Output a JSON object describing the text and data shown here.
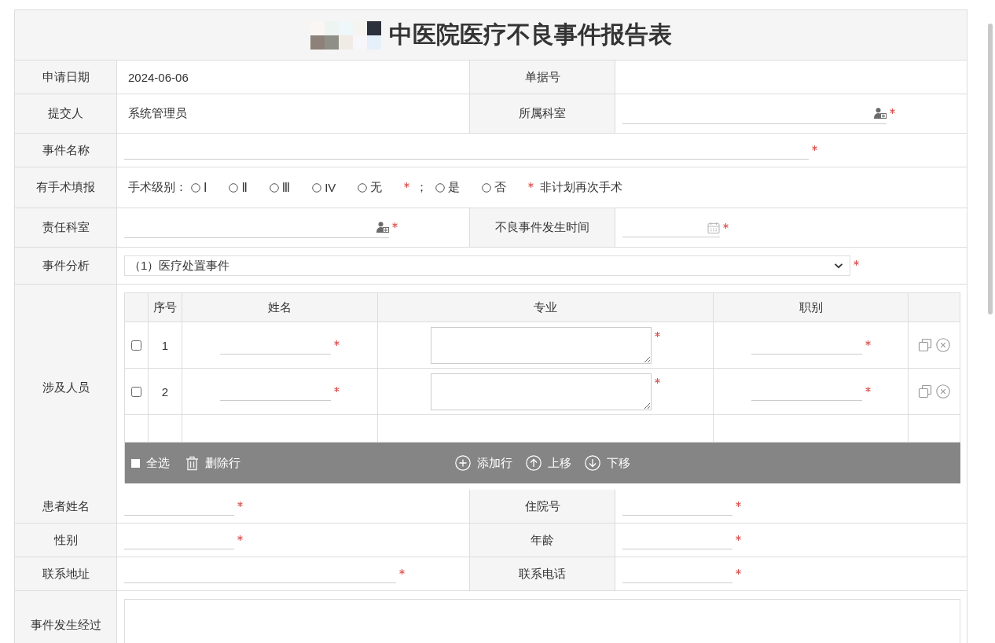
{
  "form": {
    "title": "中医院医疗不良事件报告表",
    "rows": [
      {
        "cells": [
          {
            "label": "申请日期",
            "field": {
              "kind": "static",
              "value": "2024-06-06"
            }
          },
          {
            "label": "单据号"
          }
        ]
      },
      {
        "cells": [
          {
            "label": "提交人",
            "field": {
              "kind": "static",
              "value": "系统管理员"
            }
          },
          {
            "label": "所属科室",
            "field": {
              "kind": "lookup",
              "required": true
            }
          }
        ]
      },
      {
        "cells": [
          {
            "label": "事件名称",
            "field": {
              "kind": "wide-input",
              "required": true
            }
          }
        ]
      },
      {
        "cells": [
          {
            "label": "有手术填报",
            "field": {
              "kind": "radio-groups",
              "groups": [
                {
                  "label": "手术级别：",
                  "options": [
                    {
                      "label": "Ⅰ",
                      "selected": false
                    },
                    {
                      "label": "Ⅱ",
                      "selected": false
                    },
                    {
                      "label": "Ⅲ",
                      "selected": false
                    },
                    {
                      "label": "IV",
                      "selected": false
                    },
                    {
                      "label": "无",
                      "selected": false
                    }
                  ],
                  "required": true,
                  "suffix": "；"
                },
                {
                  "options": [
                    {
                      "label": "是",
                      "selected": false
                    },
                    {
                      "label": "否",
                      "selected": false
                    }
                  ],
                  "required": true,
                  "suffix": "非计划再次手术"
                }
              ]
            }
          }
        ]
      },
      {
        "cells": [
          {
            "label": "责任科室",
            "field": {
              "kind": "lookup",
              "required": true
            }
          },
          {
            "label": "不良事件发生时间",
            "field": {
              "kind": "date",
              "required": true
            }
          }
        ]
      },
      {
        "cells": [
          {
            "label": "事件分析",
            "field": {
              "kind": "select",
              "value": "（1）医疗处置事件",
              "required": true
            }
          }
        ]
      },
      {
        "cells": [
          {
            "label": "涉及人员",
            "field": {
              "kind": "grid",
              "columns": [
                "序号",
                "姓名",
                "专业",
                "职别"
              ],
              "rows": [
                {
                  "checked": false,
                  "number": "1",
                  "cells": [
                    {
                      "kind": "input",
                      "required": true
                    },
                    {
                      "kind": "textarea",
                      "required": true
                    },
                    {
                      "kind": "input",
                      "required": true
                    }
                  ]
                },
                {
                  "checked": false,
                  "number": "2",
                  "cells": [
                    {
                      "kind": "input",
                      "required": true
                    },
                    {
                      "kind": "textarea",
                      "required": true
                    },
                    {
                      "kind": "input",
                      "required": true
                    }
                  ]
                }
              ],
              "toolbar": {
                "left": [
                  {
                    "kind": "select-all",
                    "label": "全选"
                  },
                  {
                    "kind": "delete",
                    "label": "删除行"
                  }
                ],
                "center": [
                  {
                    "kind": "add",
                    "label": "添加行"
                  },
                  {
                    "kind": "move-up",
                    "label": "上移"
                  },
                  {
                    "kind": "move-down",
                    "label": "下移"
                  }
                ]
              }
            }
          }
        ]
      },
      {
        "cells": [
          {
            "label": "患者姓名",
            "field": {
              "kind": "input",
              "required": true
            }
          },
          {
            "label": "住院号",
            "field": {
              "kind": "input",
              "required": true
            }
          }
        ]
      },
      {
        "cells": [
          {
            "label": "性别",
            "field": {
              "kind": "input",
              "required": true
            }
          },
          {
            "label": "年龄",
            "field": {
              "kind": "input",
              "required": true
            }
          }
        ]
      },
      {
        "cells": [
          {
            "label": "联系地址",
            "field": {
              "kind": "wide-input",
              "required": true
            }
          },
          {
            "label": "联系电话",
            "field": {
              "kind": "input",
              "required": true
            }
          }
        ]
      },
      {
        "cells": [
          {
            "label": "事件发生经过",
            "field": {
              "kind": "textarea"
            }
          }
        ]
      }
    ]
  }
}
